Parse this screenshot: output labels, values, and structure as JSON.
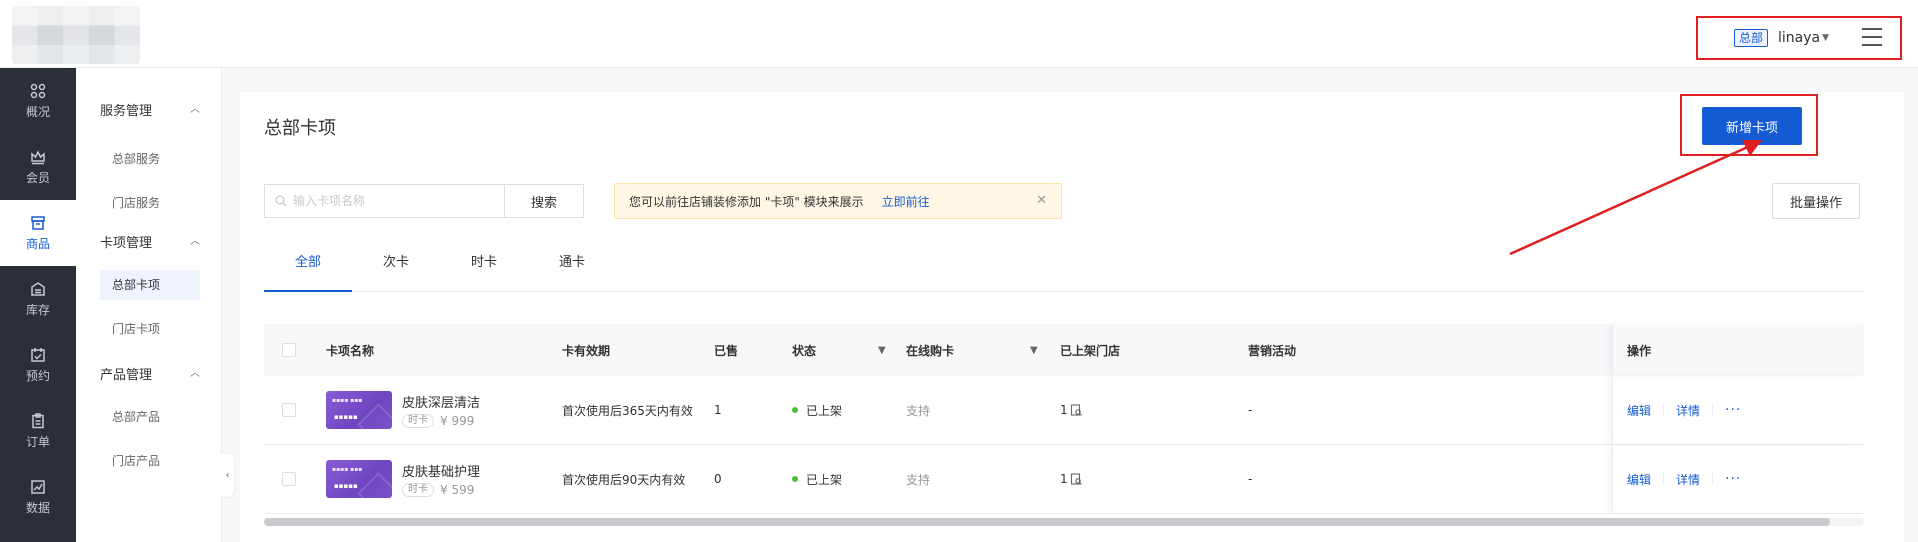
{
  "header": {
    "hq_tag": "总部",
    "user_name": "linaya"
  },
  "nav_primary": [
    {
      "label": "概况",
      "icon": "grid-icon"
    },
    {
      "label": "会员",
      "icon": "crown-icon"
    },
    {
      "label": "商品",
      "icon": "store-icon",
      "active": true
    },
    {
      "label": "库存",
      "icon": "inventory-icon"
    },
    {
      "label": "预约",
      "icon": "calendar-icon"
    },
    {
      "label": "订单",
      "icon": "clipboard-icon"
    },
    {
      "label": "数据",
      "icon": "chart-icon"
    }
  ],
  "nav_secondary": {
    "groups": [
      {
        "label": "服务管理",
        "items": [
          "总部服务",
          "门店服务"
        ]
      },
      {
        "label": "卡项管理",
        "items": [
          "总部卡项",
          "门店卡项"
        ]
      },
      {
        "label": "产品管理",
        "items": [
          "总部产品",
          "门店产品"
        ]
      }
    ],
    "active_item": "总部卡项"
  },
  "page": {
    "title": "总部卡项",
    "add_button": "新增卡项",
    "search_placeholder": "输入卡项名称",
    "search_button": "搜索",
    "notice_text": "您可以前往店铺装修添加 \"卡项\" 模块来展示",
    "notice_link": "立即前往",
    "batch_button": "批量操作",
    "tabs": [
      "全部",
      "次卡",
      "时卡",
      "通卡"
    ],
    "active_tab": "全部"
  },
  "table": {
    "columns": {
      "name": "卡项名称",
      "validity": "卡有效期",
      "sold": "已售",
      "status": "状态",
      "online": "在线购卡",
      "stores": "已上架门店",
      "marketing": "营销活动",
      "ops": "操作"
    },
    "rows": [
      {
        "name": "皮肤深层清洁",
        "card_type": "时卡",
        "price": "¥ 999",
        "validity": "首次使用后365天内有效",
        "sold": "1",
        "status": "已上架",
        "online": "支持",
        "stores": "1",
        "marketing": "-",
        "edit": "编辑",
        "detail": "详情",
        "more": "···"
      },
      {
        "name": "皮肤基础护理",
        "card_type": "时卡",
        "price": "¥ 599",
        "validity": "首次使用后90天内有效",
        "sold": "0",
        "status": "已上架",
        "online": "支持",
        "stores": "1",
        "marketing": "-",
        "edit": "编辑",
        "detail": "详情",
        "more": "···"
      }
    ]
  },
  "colors": {
    "primary": "#155bd4",
    "sidebar_dark": "#2b2f38",
    "status_green": "#4dbf33",
    "annotation_red": "#e02020",
    "thumb_purple": "#7b52c9"
  }
}
